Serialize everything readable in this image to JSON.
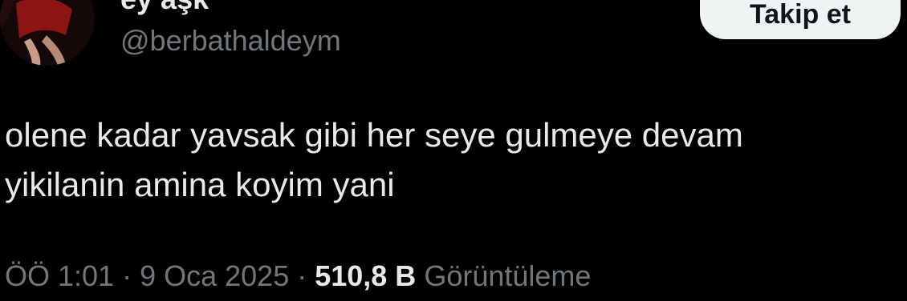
{
  "author": {
    "display_name": "ey aşk",
    "handle": "@berbathaldeym"
  },
  "follow_button": {
    "label": "Takip et"
  },
  "tweet": {
    "lines": [
      "olene kadar yavsak gibi her seye gulmeye devam",
      "yikilanin amina koyim yani"
    ]
  },
  "meta": {
    "time": "ÖÖ 1:01",
    "separator": "·",
    "date": "9 Oca 2025",
    "views_count": "510,8 B",
    "views_label": "Görüntüleme"
  },
  "colors": {
    "background": "#000000",
    "primary_text": "#e7e9ea",
    "secondary_text": "#71767b",
    "follow_button_bg": "#eff3f4"
  },
  "icons": {
    "avatar": "profile-photo"
  }
}
